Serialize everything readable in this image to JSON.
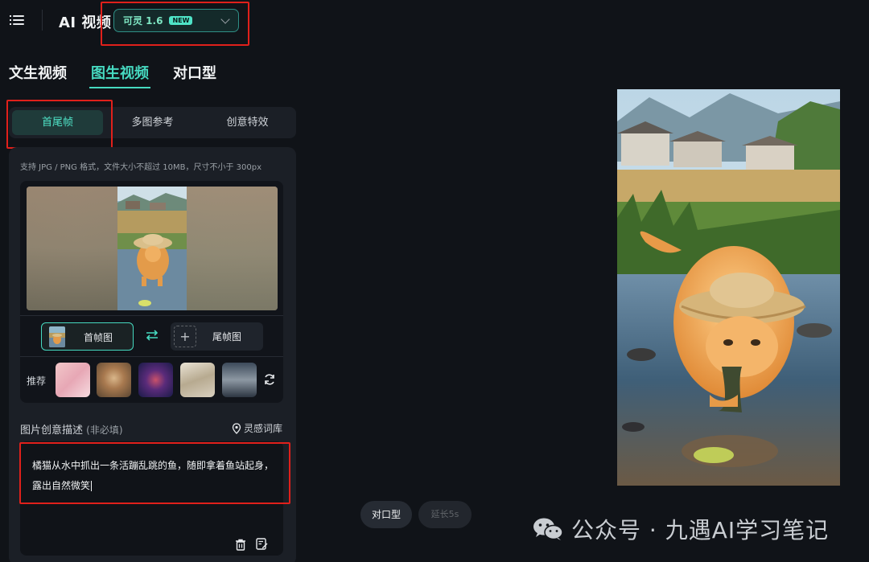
{
  "header": {
    "app_title": "AI 视频",
    "model": {
      "name": "可灵 1.6",
      "badge": "NEW"
    }
  },
  "main_tabs": [
    {
      "label": "文生视频",
      "active": false
    },
    {
      "label": "图生视频",
      "active": true
    },
    {
      "label": "对口型",
      "active": false
    }
  ],
  "sub_tabs": [
    {
      "label": "首尾帧",
      "active": true
    },
    {
      "label": "多图参考",
      "active": false
    },
    {
      "label": "创意特效",
      "active": false
    }
  ],
  "upload": {
    "hint": "支持 JPG / PNG 格式，文件大小不超过 10MB，尺寸不小于 300px",
    "first_frame_label": "首帧图",
    "last_frame_label": "尾帧图",
    "recommend_label": "推荐"
  },
  "description": {
    "label": "图片创意描述",
    "optional": "(非必填)",
    "inspiration_link": "灵感词库",
    "text": "橘猫从水中抓出一条活蹦乱跳的鱼，随即拿着鱼站起身，露出自然微笑"
  },
  "bottom_actions": {
    "lipsync": "对口型",
    "extend": "延长5s"
  },
  "watermark": {
    "text": "公众号 · 九遇AI学习笔记"
  },
  "colors": {
    "accent": "#46d9c0",
    "background": "#101318",
    "panel": "#1b1f26",
    "highlight_box": "#e0201b"
  }
}
